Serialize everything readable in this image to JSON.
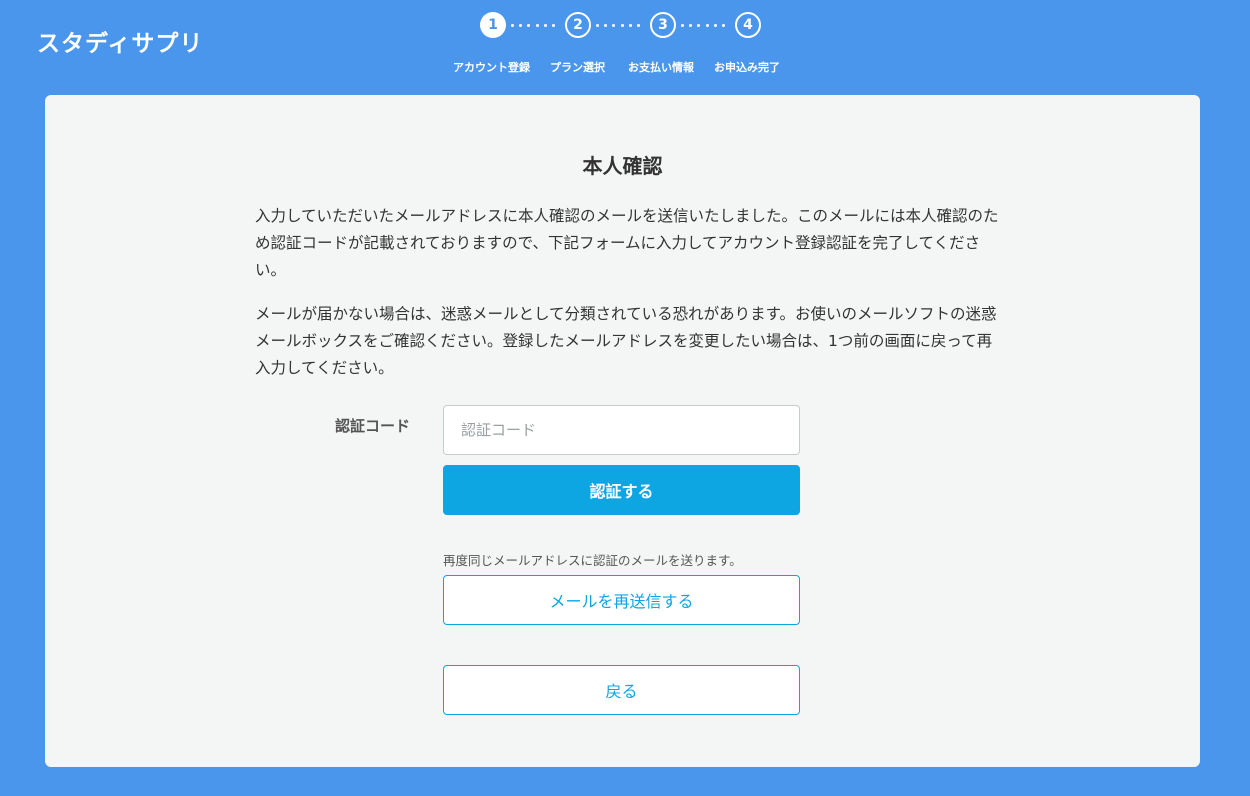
{
  "header": {
    "logo": "スタディサプリ",
    "steps": [
      {
        "number": "1",
        "label": "アカウント登録",
        "active": true
      },
      {
        "number": "2",
        "label": "プラン選択",
        "active": false
      },
      {
        "number": "3",
        "label": "お支払い情報",
        "active": false
      },
      {
        "number": "4",
        "label": "お申込み完了",
        "active": false
      }
    ]
  },
  "main": {
    "title": "本人確認",
    "paragraph1": "入力していただいたメールアドレスに本人確認のメールを送信いたしました。このメールには本人確認のため認証コードが記載されておりますので、下記フォームに入力してアカウント登録認証を完了してください。",
    "paragraph2": "メールが届かない場合は、迷惑メールとして分類されている恐れがあります。お使いのメールソフトの迷惑メールボックスをご確認ください。登録したメールアドレスを変更したい場合は、1つ前の画面に戻って再入力してください。",
    "code_label": "認証コード",
    "code_placeholder": "認証コード",
    "code_value": "",
    "submit_label": "認証する",
    "resend_note": "再度同じメールアドレスに認証のメールを送ります。",
    "resend_label": "メールを再送信する",
    "back_label": "戻る"
  },
  "colors": {
    "background": "#4a96ec",
    "card": "#f4f6f6",
    "accent": "#0ea5e3"
  }
}
